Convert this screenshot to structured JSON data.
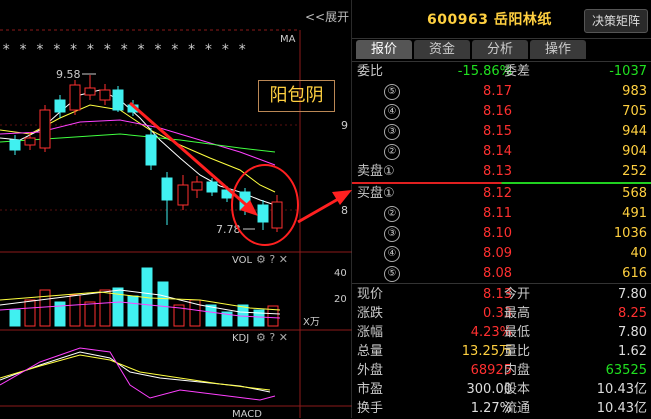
{
  "header": {
    "code": "600963",
    "name": "岳阳林纸",
    "button": "决策矩阵",
    "expand": "<<展开"
  },
  "tabs": [
    "报价",
    "资金",
    "分析",
    "操作"
  ],
  "top": {
    "l1": "委比",
    "v1": "-15.86%",
    "l2": "委差",
    "v2": "-1037"
  },
  "sell": [
    {
      "label": "⑤",
      "price": "8.17",
      "vol": "983"
    },
    {
      "label": "④",
      "price": "8.16",
      "vol": "705"
    },
    {
      "label": "③",
      "price": "8.15",
      "vol": "944"
    },
    {
      "label": "②",
      "price": "8.14",
      "vol": "904"
    },
    {
      "label": "卖盘①",
      "price": "8.13",
      "vol": "252"
    }
  ],
  "buy": [
    {
      "label": "买盘①",
      "price": "8.12",
      "vol": "568"
    },
    {
      "label": "②",
      "price": "8.11",
      "vol": "491"
    },
    {
      "label": "③",
      "price": "8.10",
      "vol": "1036"
    },
    {
      "label": "④",
      "price": "8.09",
      "vol": "40"
    },
    {
      "label": "⑤",
      "price": "8.08",
      "vol": "616"
    }
  ],
  "stats": [
    {
      "l1": "现价",
      "v1": "8.13",
      "c1": "red",
      "l2": "今开",
      "v2": "7.80",
      "c2": "white"
    },
    {
      "l1": "涨跌",
      "v1": "0.33",
      "c1": "red",
      "l2": "最高",
      "v2": "8.25",
      "c2": "red"
    },
    {
      "l1": "涨幅",
      "v1": "4.23%",
      "c1": "red",
      "l2": "最低",
      "v2": "7.80",
      "c2": "white"
    },
    {
      "l1": "总量",
      "v1": "13.25万",
      "c1": "yellow",
      "l2": "量比",
      "v2": "1.62",
      "c2": "white"
    },
    {
      "l1": "外盘",
      "v1": "68925",
      "c1": "red",
      "l2": "内盘",
      "v2": "63525",
      "c2": "green"
    },
    {
      "l1": "市盈",
      "v1": "300.00",
      "c1": "white",
      "l2": "股本",
      "v2": "10.43亿",
      "c2": "white"
    },
    {
      "l1": "换手",
      "v1": "1.27%",
      "c1": "white",
      "l2": "流通",
      "v2": "10.43亿",
      "c2": "white"
    }
  ],
  "chart": {
    "ma_label": "MA",
    "high_label": "9.58",
    "low_label": "7.78",
    "annotation": "阳包阴",
    "price_ticks": [
      "9",
      "8"
    ],
    "vol_label": "VOL",
    "vol_ticks": [
      "40",
      "20"
    ],
    "vol_unit": "X万",
    "kdj_label": "KDJ",
    "macd_label": "MACD"
  }
}
